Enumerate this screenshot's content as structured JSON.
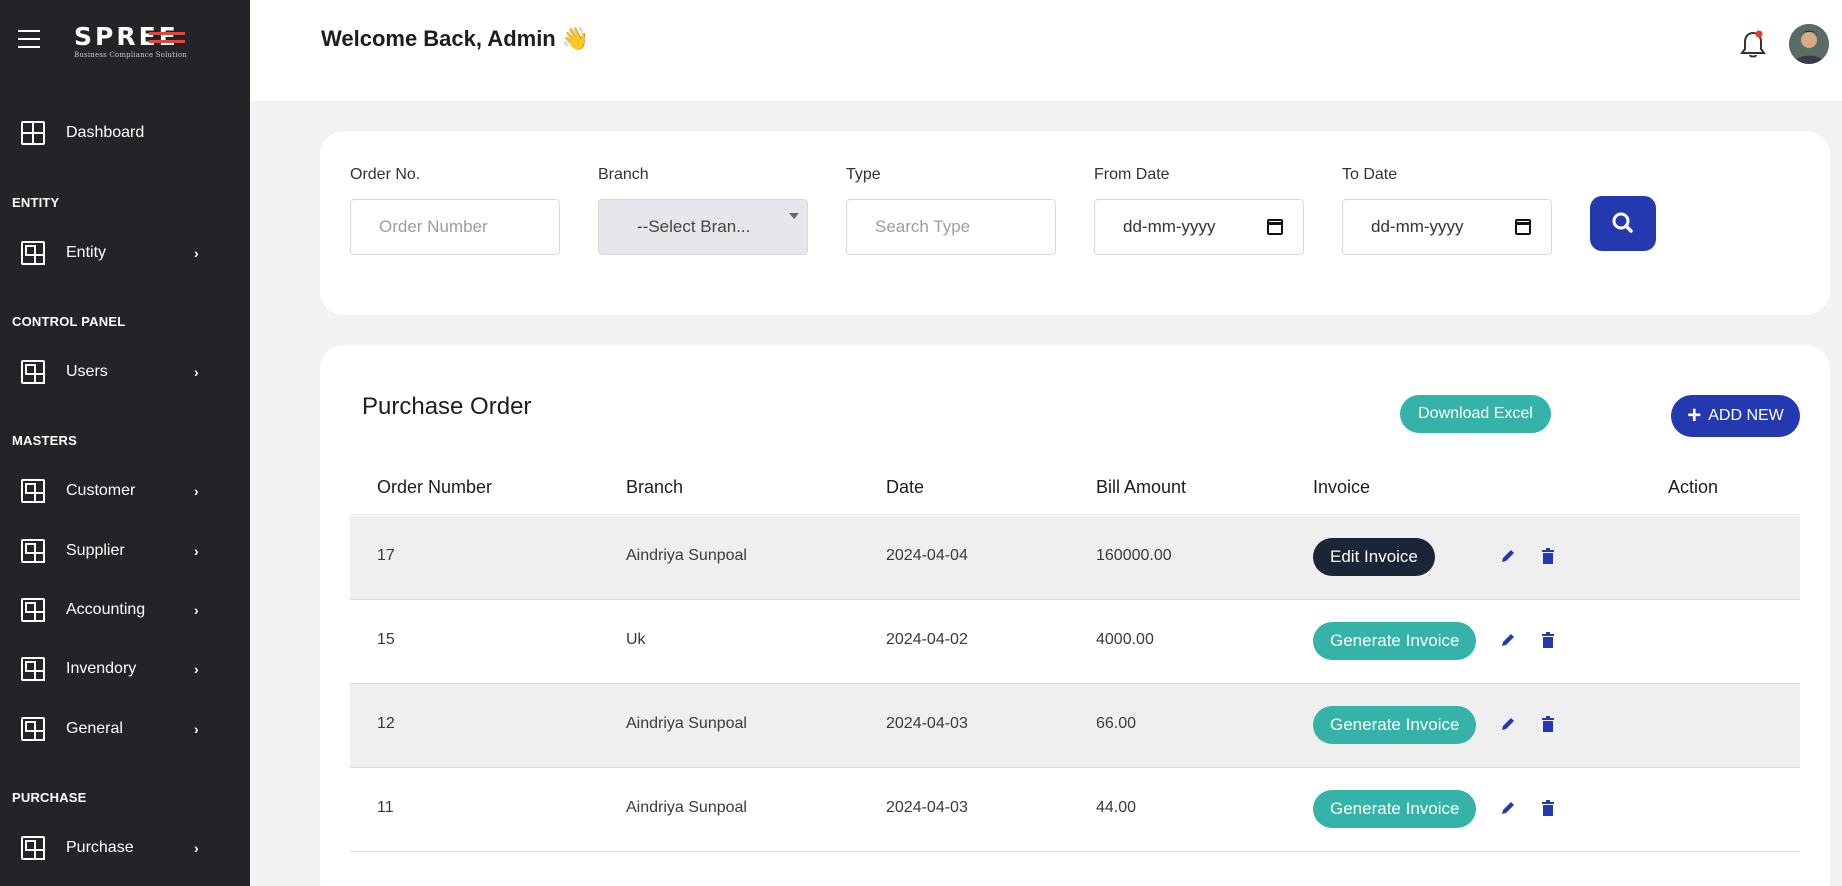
{
  "brand": {
    "name": "SPREE",
    "tagline": "Business Compliance Solution"
  },
  "sidebar": {
    "dashboard": "Dashboard",
    "sections": {
      "entity": "ENTITY",
      "control_panel": "CONTROL PANEL",
      "masters": "MASTERS",
      "purchase": "PURCHASE"
    },
    "items": {
      "entity": "Entity",
      "users": "Users",
      "customer": "Customer",
      "supplier": "Supplier",
      "accounting": "Accounting",
      "inventory": "Invendory",
      "general": "General",
      "purchase": "Purchase"
    },
    "chevron": "›"
  },
  "header": {
    "welcome": "Welcome Back, Admin 👋"
  },
  "filters": {
    "order_no": {
      "label": "Order No.",
      "placeholder": "Order Number"
    },
    "branch": {
      "label": "Branch",
      "value": "--Select Bran..."
    },
    "type": {
      "label": "Type",
      "placeholder": "Search Type"
    },
    "from_date": {
      "label": "From Date",
      "value": "dd-mm-yyyy"
    },
    "to_date": {
      "label": "To Date",
      "value": "dd-mm-yyyy"
    }
  },
  "purchase": {
    "title": "Purchase Order",
    "download_label": "Download Excel",
    "add_label": "ADD NEW",
    "add_icon": "+",
    "columns": [
      "Order Number",
      "Branch",
      "Date",
      "Bill Amount",
      "Invoice",
      "Action"
    ],
    "rows": [
      {
        "order": "17",
        "branch": "Aindriya Sunpoal",
        "date": "2024-04-04",
        "amount": "160000.00",
        "invoice": "Edit Invoice"
      },
      {
        "order": "15",
        "branch": "Uk",
        "date": "2024-04-02",
        "amount": "4000.00",
        "invoice": "Generate Invoice"
      },
      {
        "order": "12",
        "branch": "Aindriya Sunpoal",
        "date": "2024-04-03",
        "amount": "66.00",
        "invoice": "Generate Invoice"
      },
      {
        "order": "11",
        "branch": "Aindriya Sunpoal",
        "date": "2024-04-03",
        "amount": "44.00",
        "invoice": "Generate Invoice"
      }
    ]
  },
  "colors": {
    "sidebar_bg": "#232428",
    "primary": "#2438b0",
    "teal": "#36b3a8",
    "dark_button": "#1b2538"
  }
}
